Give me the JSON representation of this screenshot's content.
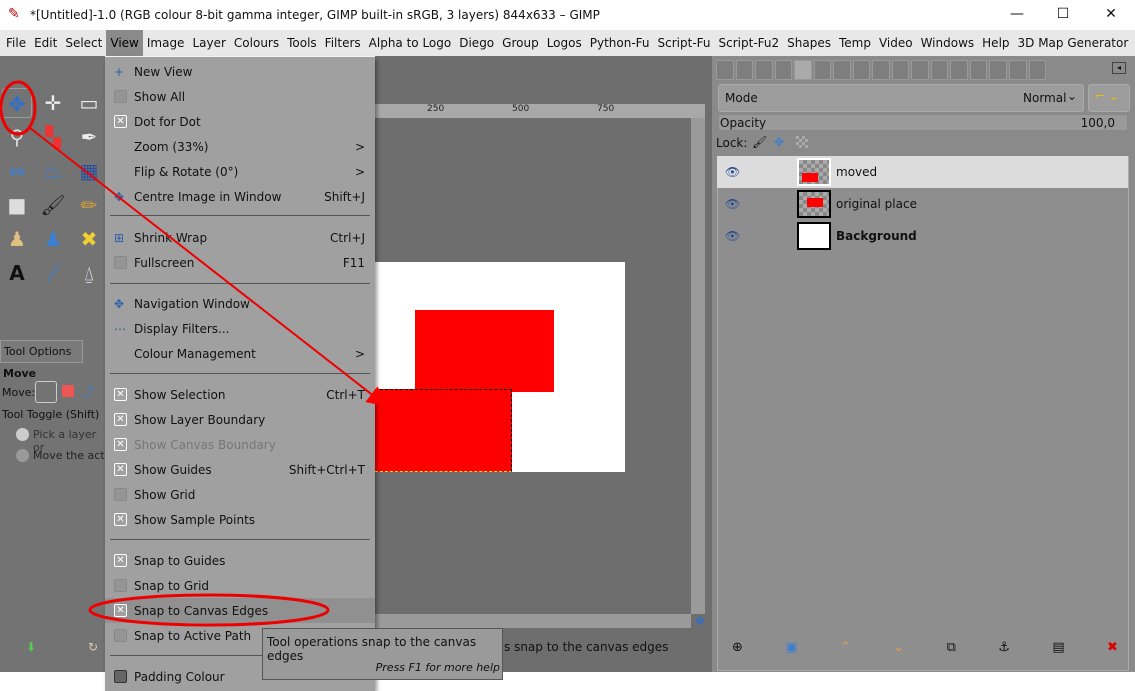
{
  "window": {
    "title": "*[Untitled]-1.0 (RGB colour 8-bit gamma integer, GIMP built-in sRGB, 3 layers) 844x633 – GIMP",
    "minimize": "—",
    "maximize": "☐",
    "close": "✕"
  },
  "menubar": [
    "File",
    "Edit",
    "Select",
    "View",
    "Image",
    "Layer",
    "Colours",
    "Tools",
    "Filters",
    "Alpha to Logo",
    "Diego",
    "Group",
    "Logos",
    "Python-Fu",
    "Script-Fu",
    "Script-Fu2",
    "Shapes",
    "Temp",
    "Video",
    "Windows",
    "Help",
    "3D Map Generator"
  ],
  "view_menu": [
    {
      "label": "New View",
      "icon": "+"
    },
    {
      "label": "Show All",
      "check": false
    },
    {
      "label": "Dot for Dot",
      "check": true
    },
    {
      "label": "Zoom (33%)",
      "submenu": ">"
    },
    {
      "label": "Flip & Rotate (0°)",
      "submenu": ">"
    },
    {
      "label": "Centre Image in Window",
      "shortcut": "Shift+J",
      "icon": "✥"
    },
    {
      "label": "Shrink Wrap",
      "shortcut": "Ctrl+J",
      "icon": "⊞"
    },
    {
      "label": "Fullscreen",
      "shortcut": "F11",
      "check": false
    },
    {
      "label": "Navigation Window",
      "icon": "✥"
    },
    {
      "label": "Display Filters...",
      "icon": "⋯"
    },
    {
      "label": "Colour Management",
      "submenu": ">"
    },
    {
      "label": "Show Selection",
      "shortcut": "Ctrl+T",
      "check": true
    },
    {
      "label": "Show Layer Boundary",
      "check": true
    },
    {
      "label": "Show Canvas Boundary",
      "check": true,
      "disabled": true
    },
    {
      "label": "Show Guides",
      "shortcut": "Shift+Ctrl+T",
      "check": true
    },
    {
      "label": "Show Grid",
      "check": false
    },
    {
      "label": "Show Sample Points",
      "check": true
    },
    {
      "label": "Snap to Guides",
      "check": true
    },
    {
      "label": "Snap to Grid",
      "check": false
    },
    {
      "label": "Snap to Canvas Edges",
      "check": true
    },
    {
      "label": "Snap to Active Path",
      "check": false
    },
    {
      "label": "Padding Colour"
    }
  ],
  "tooltip": {
    "text": "Tool operations snap to the canvas edges",
    "help": "Press F1 for more help"
  },
  "statusbar": "s snap to the canvas edges",
  "ruler": [
    "250",
    "500",
    "750"
  ],
  "tool_options": {
    "tab": "Tool Options",
    "title": "Move",
    "move_label": "Move:",
    "toggle": "Tool Toggle  (Shift)",
    "opt1": "Pick a layer or",
    "opt2": "Move the activ"
  },
  "layers": {
    "mode_label": "Mode",
    "mode_value": "Normal",
    "opacity_label": "Opacity",
    "opacity_value": "100,0",
    "lock_label": "Lock:",
    "items": [
      {
        "name": "moved",
        "selected": true
      },
      {
        "name": "original place"
      },
      {
        "name": "Background",
        "bold": true
      }
    ]
  },
  "colors": {
    "accent_red": "#ff0000"
  }
}
